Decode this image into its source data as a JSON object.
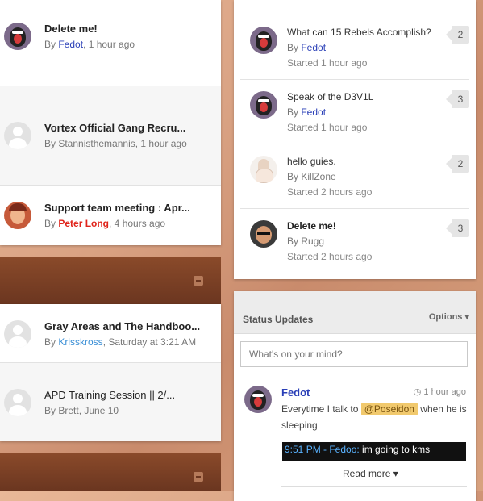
{
  "left_topics": [
    {
      "title": "Delete me!",
      "by": "By ",
      "author": "Fedot",
      "time": ", 1 hour ago",
      "avatar_icon": "penguin-avatar"
    },
    {
      "title": "Vortex Official Gang Recru...",
      "by": "By ",
      "author": "Stannisthemannis",
      "time": ", 1 hour ago",
      "avatar_icon": "default-avatar"
    },
    {
      "title": "Support team meeting : Apr...",
      "by": "By ",
      "author": "Peter Long",
      "time": ", 4 hours ago",
      "avatar_icon": "face-avatar"
    },
    {
      "title": "Gray Areas and The Handboo...",
      "by": "By ",
      "author": "Krisskross",
      "time": ", Saturday at 3:21 AM",
      "avatar_icon": "default-avatar"
    },
    {
      "title": "APD Training Session || 2/...",
      "by": "By ",
      "author": "Brett",
      "time": ", June 10",
      "avatar_icon": "default-avatar"
    }
  ],
  "right_topics": [
    {
      "title": "What can 15 Rebels Accomplish?",
      "by": "By ",
      "author": "Fedot",
      "started": "Started 1 hour ago",
      "count": "2"
    },
    {
      "title": "Speak of the D3V1L",
      "by": "By ",
      "author": "Fedot",
      "started": "Started 1 hour ago",
      "count": "3"
    },
    {
      "title": "hello guies.",
      "by": "By ",
      "author": "KillZone",
      "started": "Started 2 hours ago",
      "count": "2"
    },
    {
      "title": "Delete me!",
      "by": "By ",
      "author": "Rugg",
      "started": "Started 2 hours ago",
      "count": "3"
    }
  ],
  "status_updates": {
    "title": "Status Updates",
    "options": "Options ▾",
    "placeholder": "What's on your mind?",
    "post": {
      "author": "Fedot",
      "time": "1 hour ago",
      "text_before": "Everytime I talk to ",
      "mention": "@Poseidon",
      "text_after": " when he is sleeping",
      "chat_time": "9:51 PM - Fedoo:",
      "chat_text": " im going to kms",
      "read_more": "Read more"
    }
  },
  "colors": {
    "link": "#2a3fb7",
    "moderator": "#e0241b",
    "mention": "#f1c96d"
  }
}
